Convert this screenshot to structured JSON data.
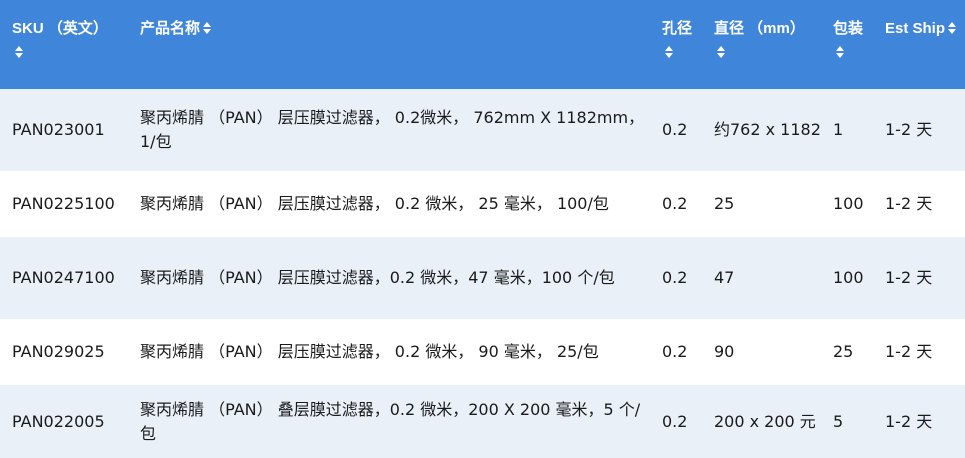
{
  "colors": {
    "header_bg": "#3f86db",
    "header_text": "#ffffff",
    "row_alt_bg": "#e9f0f8",
    "row_bg": "#ffffff"
  },
  "header": {
    "sku": "SKU （英文）",
    "name": "产品名称",
    "pore": "孔径",
    "diameter": "直径 （mm）",
    "pack": "包装",
    "ship": "Est Ship"
  },
  "rows": [
    {
      "sku": "PAN023001",
      "name": "聚丙烯腈 （PAN） 层压膜过滤器， 0.2微米， 762mm X 1182mm， 1/包",
      "pore": "0.2",
      "diameter": "约762 x 1182",
      "pack": "1",
      "ship": "1-2 天"
    },
    {
      "sku": "PAN0225100",
      "name": "聚丙烯腈 （PAN） 层压膜过滤器， 0.2 微米， 25 毫米， 100/包",
      "pore": "0.2",
      "diameter": "25",
      "pack": "100",
      "ship": "1-2 天"
    },
    {
      "sku": "PAN0247100",
      "name": "聚丙烯腈 （PAN） 层压膜过滤器，0.2 微米，47 毫米，100 个/包",
      "pore": "0.2",
      "diameter": "47",
      "pack": "100",
      "ship": "1-2 天"
    },
    {
      "sku": "PAN029025",
      "name": "聚丙烯腈 （PAN） 层压膜过滤器， 0.2 微米， 90 毫米， 25/包",
      "pore": "0.2",
      "diameter": "90",
      "pack": "25",
      "ship": "1-2 天"
    },
    {
      "sku": "PAN022005",
      "name": "聚丙烯腈 （PAN） 叠层膜过滤器，0.2 微米，200 X 200 毫米，5 个/包",
      "pore": "0.2",
      "diameter": "200 x 200 元",
      "pack": "5",
      "ship": "1-2 天"
    }
  ]
}
